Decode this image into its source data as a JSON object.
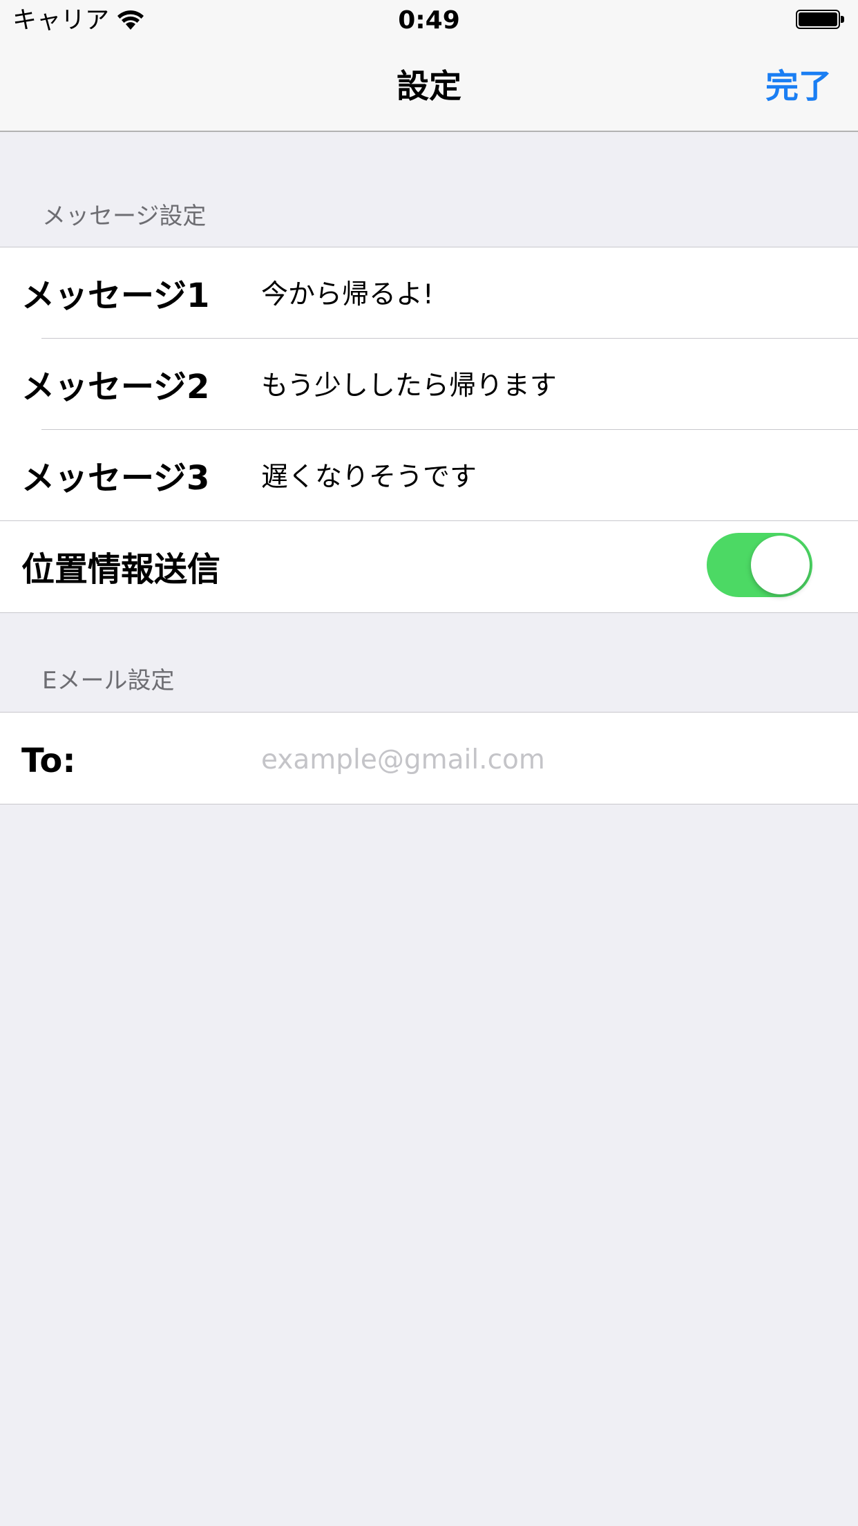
{
  "status_bar": {
    "carrier": "キャリア",
    "time": "0:49"
  },
  "nav": {
    "title": "設定",
    "done_label": "完了",
    "accent_color": "#1a7ef3"
  },
  "message_section": {
    "header": "メッセージ設定",
    "rows": [
      {
        "label": "メッセージ1",
        "value": "今から帰るよ!"
      },
      {
        "label": "メッセージ2",
        "value": "もう少ししたら帰ります"
      },
      {
        "label": "メッセージ3",
        "value": "遅くなりそうです"
      }
    ],
    "location": {
      "label": "位置情報送信",
      "enabled": true,
      "toggle_color": "#4cd964"
    }
  },
  "email_section": {
    "header": "Eメール設定",
    "to_label": "To:",
    "to_value": "",
    "to_placeholder": "example@gmail.com"
  }
}
